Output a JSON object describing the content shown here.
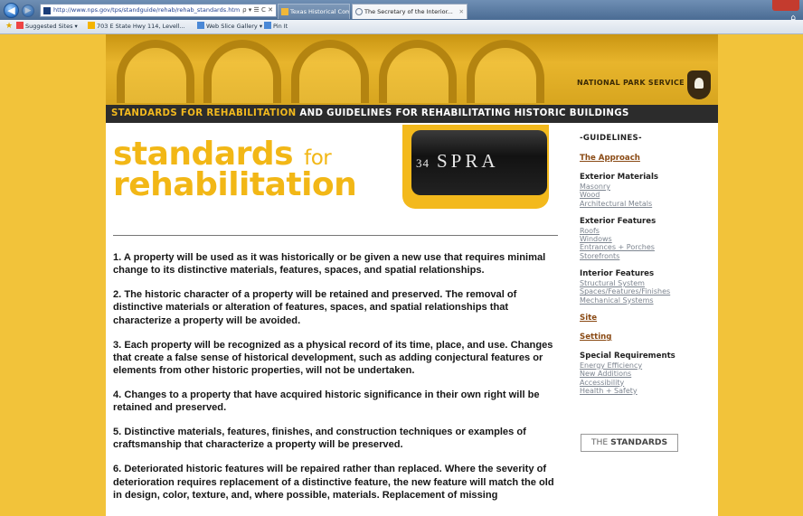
{
  "browser": {
    "url": "http://www.nps.gov/tps/standguide/rehab/rehab_standards.htm",
    "address_actions": "ρ ▾ ☰ C ✕",
    "tabs": [
      {
        "label": "Texas Historical Commission"
      },
      {
        "label": "The Secretary of the Interior..."
      }
    ],
    "tab_close": "✕",
    "favorites": [
      {
        "label": "Suggested Sites ▾"
      },
      {
        "label": "703 E State Hwy 114, Levell..."
      },
      {
        "label": "Web Slice Gallery ▾"
      },
      {
        "label": "Pin It"
      }
    ]
  },
  "banner": {
    "agency": "NATIONAL PARK SERVICE",
    "title_highlight": "STANDARDS FOR REHABILITATION",
    "title_rest": " AND GUIDELINES FOR REHABILITATING HISTORIC BUILDINGS"
  },
  "hero": {
    "line1": "standards",
    "for": "for",
    "line2": "rehabilitation",
    "photo_number": "34",
    "photo_text": "SPRA"
  },
  "standards": [
    "1. A property will be used as it was historically or be given a new use that requires minimal change to its distinctive materials, features, spaces, and spatial relationships.",
    "2. The historic character of a property will be retained and preserved. The removal of distinctive materials or alteration of features, spaces, and spatial relationships that characterize a property will be avoided.",
    "3. Each property will be recognized as a physical record of its time, place, and use. Changes that create a false sense of historical development, such as adding conjectural features or elements from other historic properties, will not be undertaken.",
    "4. Changes to a property that have acquired historic significance in their own right will be retained and preserved.",
    "5. Distinctive materials, features, finishes, and construction techniques or examples of craftsmanship that characterize a property will be preserved.",
    "6. Deteriorated historic features will be repaired rather than replaced. Where the severity of deterioration requires replacement of a distinctive feature, the new feature will match the old in design, color, texture, and, where possible, materials. Replacement of missing"
  ],
  "sidebar": {
    "heading": "-GUIDELINES-",
    "approach": "The Approach",
    "exterior_materials": {
      "title": "Exterior Materials",
      "links": [
        "Masonry",
        "Wood",
        "Architectural Metals"
      ]
    },
    "exterior_features": {
      "title": "Exterior Features",
      "links": [
        "Roofs",
        "Windows",
        "Entrances + Porches",
        "Storefronts"
      ]
    },
    "interior_features": {
      "title": "Interior Features",
      "links": [
        "Structural System",
        "Spaces/Features/Finishes",
        "Mechanical Systems"
      ]
    },
    "site": "Site",
    "setting": "Setting",
    "special": {
      "title": "Special Requirements",
      "links": [
        "Energy Efficiency",
        "New Additions",
        "Accessibility",
        "Health + Safety"
      ]
    },
    "button_prefix": "THE",
    "button_bold": "STANDARDS"
  },
  "colors": {
    "background": "#f2c33a",
    "accent_yellow": "#f2b716",
    "link_brown": "#8a4a14",
    "link_gray": "#7d8590",
    "title_bar": "#2c2c2c"
  },
  "icons": [
    "back-icon",
    "forward-icon",
    "site-icon",
    "star-icon",
    "home-icon",
    "nps-arrowhead-icon"
  ]
}
